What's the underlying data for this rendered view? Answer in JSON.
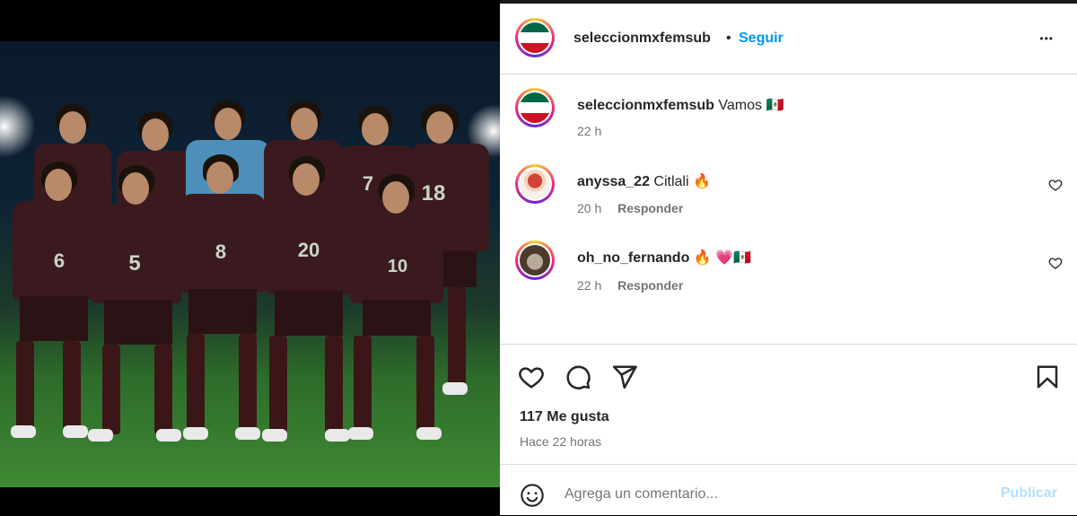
{
  "post": {
    "author": "seleccionmxfemsub",
    "follow_label": "Seguir",
    "separator": "•",
    "more_label": "•••",
    "caption_author": "seleccionmxfemsub",
    "caption_text": "Vamos 🇲🇽",
    "caption_time": "22 h"
  },
  "photo": {
    "jersey_numbers": [
      "7",
      "18",
      "6",
      "5",
      "8",
      "20",
      "10"
    ]
  },
  "comments": [
    {
      "author": "anyssa_22",
      "text": "Citlali 🔥",
      "time": "20 h",
      "reply_label": "Responder"
    },
    {
      "author": "oh_no_fernando",
      "text": "🔥 💗🇲🇽",
      "time": "22 h",
      "reply_label": "Responder"
    }
  ],
  "actions": {
    "likes": "117 Me gusta",
    "posted": "Hace 22 horas"
  },
  "add_comment": {
    "placeholder": "Agrega un comentario...",
    "publish_label": "Publicar"
  },
  "colors": {
    "accent": "#0095f6",
    "publish_disabled": "#b2dffc",
    "muted": "#737373",
    "border": "#dbdbdb"
  }
}
